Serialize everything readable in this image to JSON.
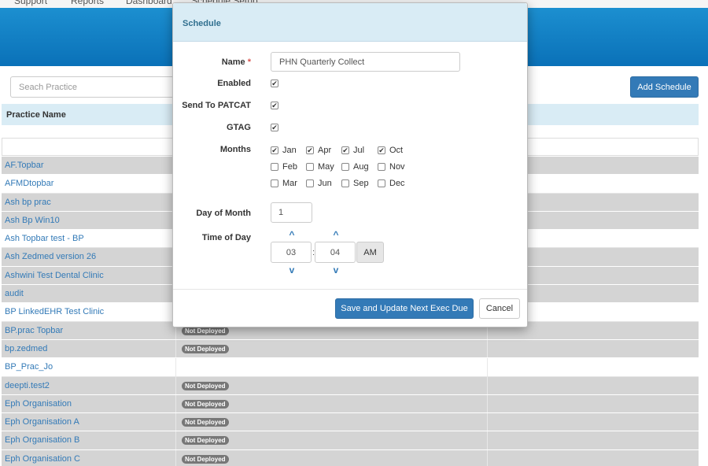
{
  "nav": {
    "items": [
      "Support",
      "Reports",
      "Dashboard",
      "Schedule Setup"
    ]
  },
  "toolbar": {
    "search_placeholder": "Seach Practice",
    "add_label": "Add Schedule"
  },
  "table": {
    "header": "Practice Name",
    "rows": [
      {
        "name": "AF.Topbar",
        "badge": ""
      },
      {
        "name": "AFMDtopbar",
        "badge": ""
      },
      {
        "name": "Ash bp prac",
        "badge": ""
      },
      {
        "name": "Ash Bp Win10",
        "badge": ""
      },
      {
        "name": "Ash Topbar test - BP",
        "badge": ""
      },
      {
        "name": "Ash Zedmed version 26",
        "badge": ""
      },
      {
        "name": "Ashwini Test Dental Clinic",
        "badge": ""
      },
      {
        "name": "audit",
        "badge": ""
      },
      {
        "name": "BP LinkedEHR Test Clinic",
        "badge": ""
      },
      {
        "name": "BP.prac Topbar",
        "badge": "Not Deployed"
      },
      {
        "name": "bp.zedmed",
        "badge": "Not Deployed"
      },
      {
        "name": "BP_Prac_Jo",
        "badge": ""
      },
      {
        "name": "deepti.test2",
        "badge": "Not Deployed"
      },
      {
        "name": "Eph Organisation",
        "badge": "Not Deployed"
      },
      {
        "name": "Eph Organisation A",
        "badge": "Not Deployed"
      },
      {
        "name": "Eph Organisation B",
        "badge": "Not Deployed"
      },
      {
        "name": "Eph Organisation C",
        "badge": "Not Deployed"
      }
    ]
  },
  "modal": {
    "title": "Schedule",
    "name_label": "Name",
    "required_mark": "*",
    "name_value": "PHN Quarterly Collect",
    "enabled_label": "Enabled",
    "enabled": true,
    "patcat_label": "Send To PATCAT",
    "patcat": true,
    "gtag_label": "GTAG",
    "gtag": true,
    "months_label": "Months",
    "months": [
      {
        "label": "Jan",
        "checked": true
      },
      {
        "label": "Apr",
        "checked": true
      },
      {
        "label": "Jul",
        "checked": true
      },
      {
        "label": "Oct",
        "checked": true
      },
      {
        "label": "Feb",
        "checked": false
      },
      {
        "label": "May",
        "checked": false
      },
      {
        "label": "Aug",
        "checked": false
      },
      {
        "label": "Nov",
        "checked": false
      },
      {
        "label": "Mar",
        "checked": false
      },
      {
        "label": "Jun",
        "checked": false
      },
      {
        "label": "Sep",
        "checked": false
      },
      {
        "label": "Dec",
        "checked": false
      }
    ],
    "day_label": "Day of Month",
    "day_value": "1",
    "time_label": "Time of Day",
    "hour": "03",
    "separator": ":",
    "minute": "04",
    "ampm": "AM",
    "save_label": "Save and Update Next Exec Due",
    "cancel_label": "Cancel",
    "colors": {
      "primary": "#337ab7",
      "header_bg": "#d9ecf5",
      "banner": "#0a71b8",
      "badge": "#777777"
    }
  }
}
